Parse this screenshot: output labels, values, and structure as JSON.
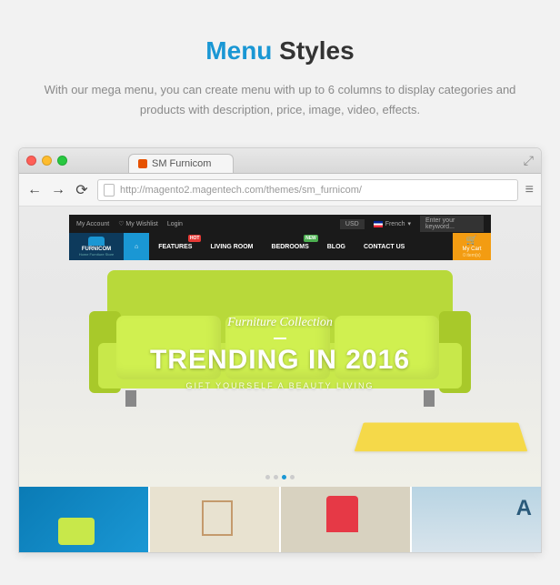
{
  "heading": {
    "accent": "Menu",
    "rest": " Styles"
  },
  "subtitle": "With our mega menu, you can create menu with up to 6 columns to display categories and products with description, price, image, video, effects.",
  "browser": {
    "tab_title": "SM Furnicom",
    "url": "http://magento2.magentech.com/themes/sm_furnicom/"
  },
  "topbar": {
    "account": "My Account",
    "wishlist": "My Wishlist",
    "login": "Login",
    "currency": "USD",
    "lang": "French",
    "search_placeholder": "Enter your keyword..."
  },
  "logo": {
    "name": "FURNICOM",
    "tagline": "Home Furniture Store"
  },
  "menu": {
    "items": [
      {
        "label": "⌂",
        "name": "home"
      },
      {
        "label": "FEATURES",
        "name": "features",
        "badge": "HOT",
        "badge_class": "hot"
      },
      {
        "label": "LIVING ROOM",
        "name": "living-room"
      },
      {
        "label": "BEDROOMS",
        "name": "bedrooms",
        "badge": "NEW",
        "badge_class": "new"
      },
      {
        "label": "BLOG",
        "name": "blog"
      },
      {
        "label": "CONTACT US",
        "name": "contact"
      }
    ]
  },
  "cart": {
    "label": "My Cart",
    "count": "0 item(s)"
  },
  "hero": {
    "supertitle": "Furniture Collection",
    "title": "TRENDING IN 2016",
    "subtitle": "GIFT YOURSELF A BEAUTY LIVING"
  },
  "pager": {
    "count": 4,
    "active": 2
  }
}
